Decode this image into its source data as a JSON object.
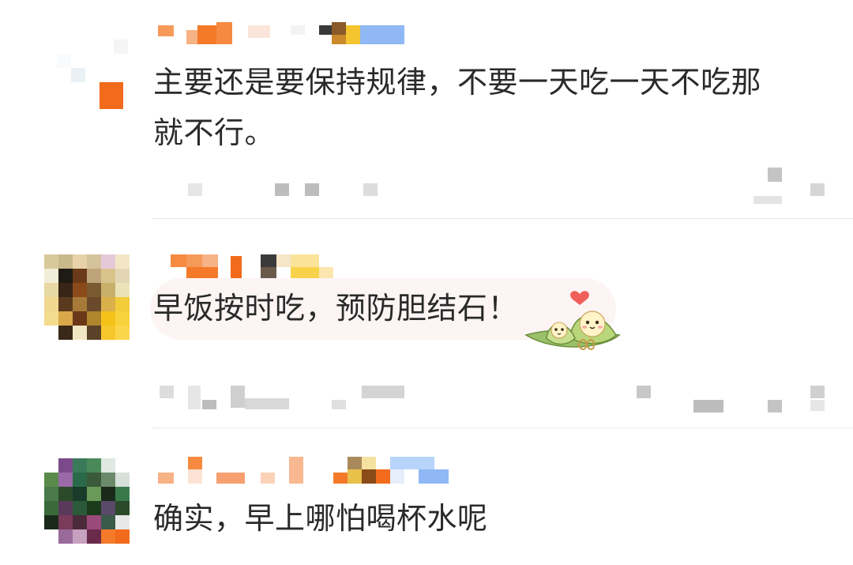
{
  "comments": [
    {
      "text": "主要还是要保持规律，不要一天吃一天不吃那就不行。",
      "text_line1": "主要还是要保持规律，不要一天吃一天不吃那",
      "text_line2": "就不行。",
      "username_obscured": true,
      "avatar_obscured": true
    },
    {
      "text": "早饭按时吃，预防胆结石！",
      "username_obscured": true,
      "avatar_obscured": true,
      "sticker": "zongzi-couple-sticker"
    },
    {
      "text": "确实，早上哪怕喝杯水呢",
      "username_obscured": true,
      "avatar_obscured": true
    }
  ],
  "colors": {
    "text": "#2a2a2a",
    "divider": "#e9e9e9",
    "bubble": "#fdf4f4",
    "mosaic_orange": "#f47a2a",
    "mosaic_blue": "#8fb8f5",
    "mosaic_gray": "#cfcfcf"
  }
}
